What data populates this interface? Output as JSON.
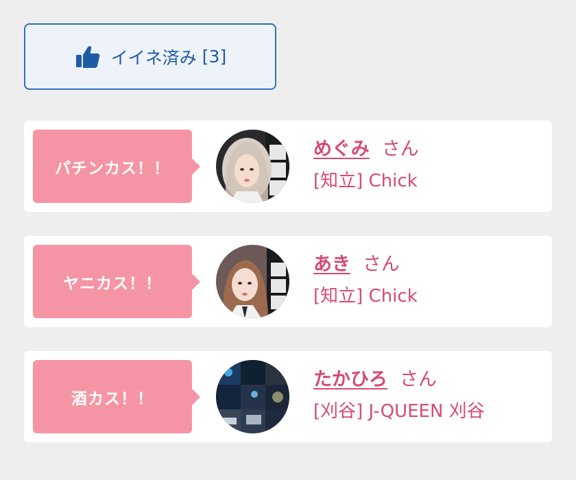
{
  "like_button": {
    "label": "イイネ済み",
    "count": "[3]",
    "icon": "thumbs-up-icon",
    "color": "#2e6fc2"
  },
  "colors": {
    "tag_bg": "#f595a4",
    "accent_text": "#d64a72",
    "page_bg": "#eeeeef"
  },
  "cards": [
    {
      "tag": "パチンカス！！",
      "name": "めぐみ",
      "suffix": "さん",
      "shop": "[知立] Chick",
      "avatar_icon": "girl-portrait-blonde"
    },
    {
      "tag": "ヤニカス！！",
      "name": "あき",
      "suffix": "さん",
      "shop": "[知立] Chick",
      "avatar_icon": "girl-portrait-brown"
    },
    {
      "tag": "酒カス！！",
      "name": "たかひろ",
      "suffix": "さん",
      "shop": "[刈谷] J-QUEEN 刈谷",
      "avatar_icon": "collage-photo"
    }
  ]
}
